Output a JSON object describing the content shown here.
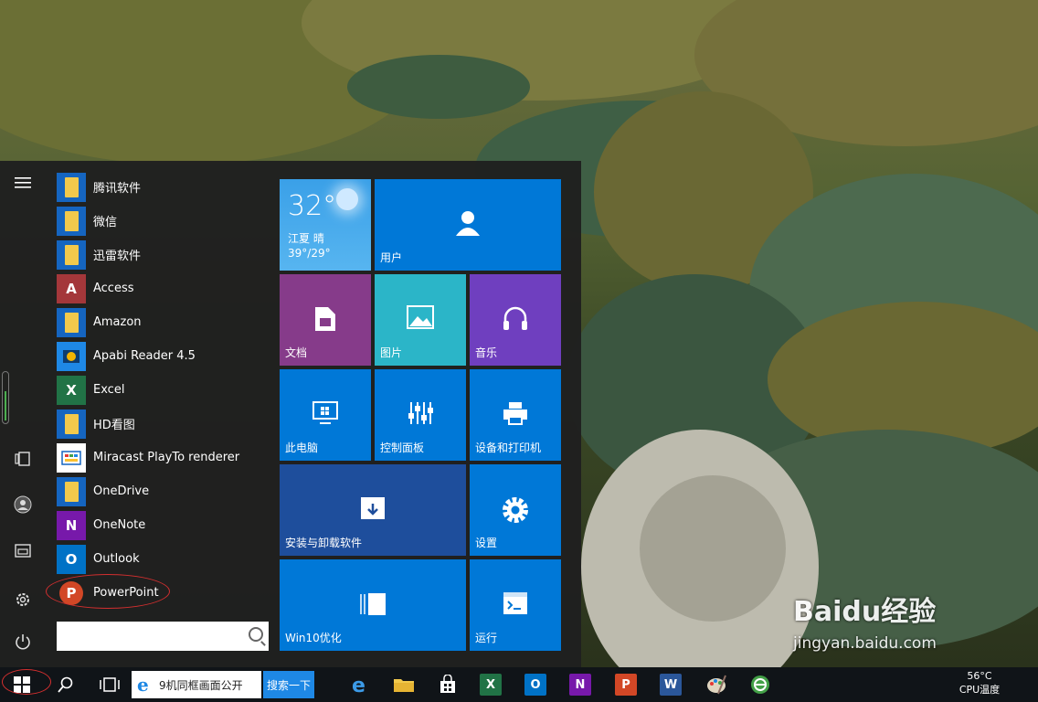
{
  "start_menu": {
    "apps": [
      {
        "label": "腾讯软件",
        "icon": "folder-icon"
      },
      {
        "label": "微信",
        "icon": "folder-icon"
      },
      {
        "label": "迅雷软件",
        "icon": "folder-icon"
      },
      {
        "label": "Access",
        "icon": "access-icon",
        "glyph": "A",
        "color": "#a4373a"
      },
      {
        "label": "Amazon",
        "icon": "folder-icon"
      },
      {
        "label": "Apabi Reader 4.5",
        "icon": "apabi-icon",
        "color": "#1e88e5"
      },
      {
        "label": "Excel",
        "icon": "excel-icon",
        "glyph": "X",
        "color": "#217346"
      },
      {
        "label": "HD看图",
        "icon": "folder-icon"
      },
      {
        "label": "Miracast PlayTo renderer",
        "icon": "miracast-icon",
        "color": "#1565c0"
      },
      {
        "label": "OneDrive",
        "icon": "folder-icon"
      },
      {
        "label": "OneNote",
        "icon": "onenote-icon",
        "glyph": "N",
        "color": "#7719aa"
      },
      {
        "label": "Outlook",
        "icon": "outlook-icon",
        "glyph": "O",
        "color": "#0072c6"
      },
      {
        "label": "PowerPoint",
        "icon": "powerpoint-icon",
        "glyph": "P",
        "color": "#d24726"
      }
    ],
    "search_placeholder": "",
    "tiles": {
      "weather": {
        "temp": "32°",
        "city": "江夏 晴",
        "range": "39°/29°"
      },
      "user": "用户",
      "documents": "文档",
      "pictures": "图片",
      "music": "音乐",
      "this_pc": "此电脑",
      "control_panel": "控制面板",
      "devices_printers": "设备和打印机",
      "install_uninstall": "安装与卸载软件",
      "settings": "设置",
      "win10_opt": "Win10优化",
      "run": "运行"
    },
    "colors": {
      "accent": "#0078d7",
      "purple_tile": "#863b8a",
      "teal_tile": "#2bb5c8",
      "violet_tile": "#6f3fbf",
      "dark_blue_tile": "#1e4e9c"
    }
  },
  "taskbar": {
    "search_text": "9机同框画面公开",
    "search_button": "搜索一下",
    "cpu_temp": "56°C",
    "cpu_label": "CPU温度",
    "apps": [
      "edge-icon",
      "file-explorer-icon",
      "store-icon",
      "excel-icon",
      "outlook-icon",
      "onenote-icon",
      "powerpoint-icon",
      "word-icon",
      "paint-icon",
      "360-browser-icon"
    ]
  },
  "watermark": {
    "brand": "Baidu经验",
    "url": "jingyan.baidu.com"
  }
}
